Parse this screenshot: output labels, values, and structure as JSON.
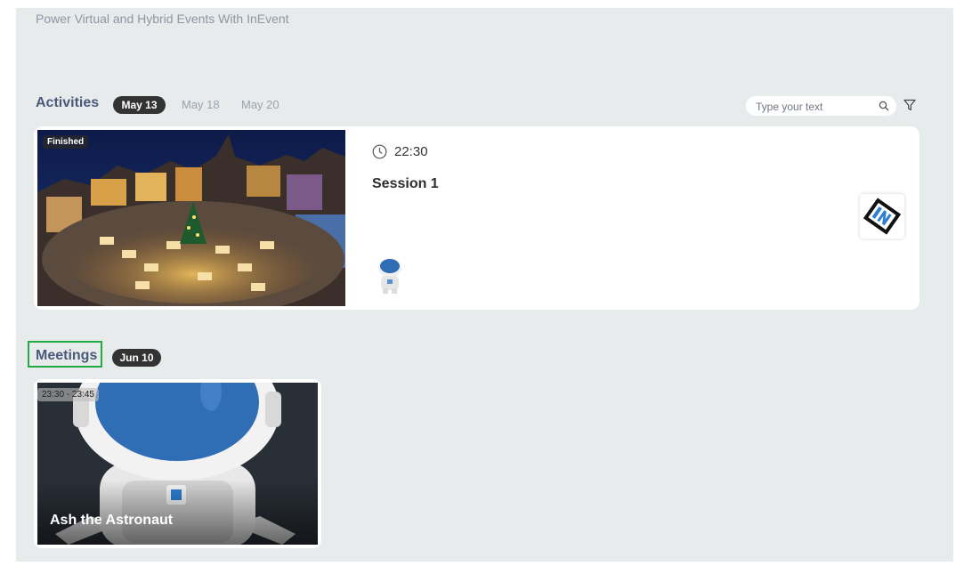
{
  "header": {
    "subtitle": "Power Virtual and Hybrid Events With InEvent"
  },
  "activities": {
    "title": "Activities",
    "dates": [
      "May 13",
      "May 18",
      "May 20"
    ],
    "selected_date": "May 13",
    "search": {
      "placeholder": "Type your text",
      "value": ""
    },
    "session": {
      "status": "Finished",
      "time": "22:30",
      "title": "Session 1"
    }
  },
  "meetings": {
    "title": "Meetings",
    "date": "Jun 10",
    "card": {
      "time_range": "23:30 - 23:45",
      "name": "Ash the Astronaut"
    }
  },
  "colors": {
    "panel_bg": "#e8ebec",
    "section_title": "#4a5a78",
    "pill_bg": "#333333",
    "highlight_box": "#22aa44"
  },
  "icons": [
    "clock-icon",
    "search-icon",
    "filter-icon",
    "inevent-logo",
    "astronaut-avatar"
  ]
}
